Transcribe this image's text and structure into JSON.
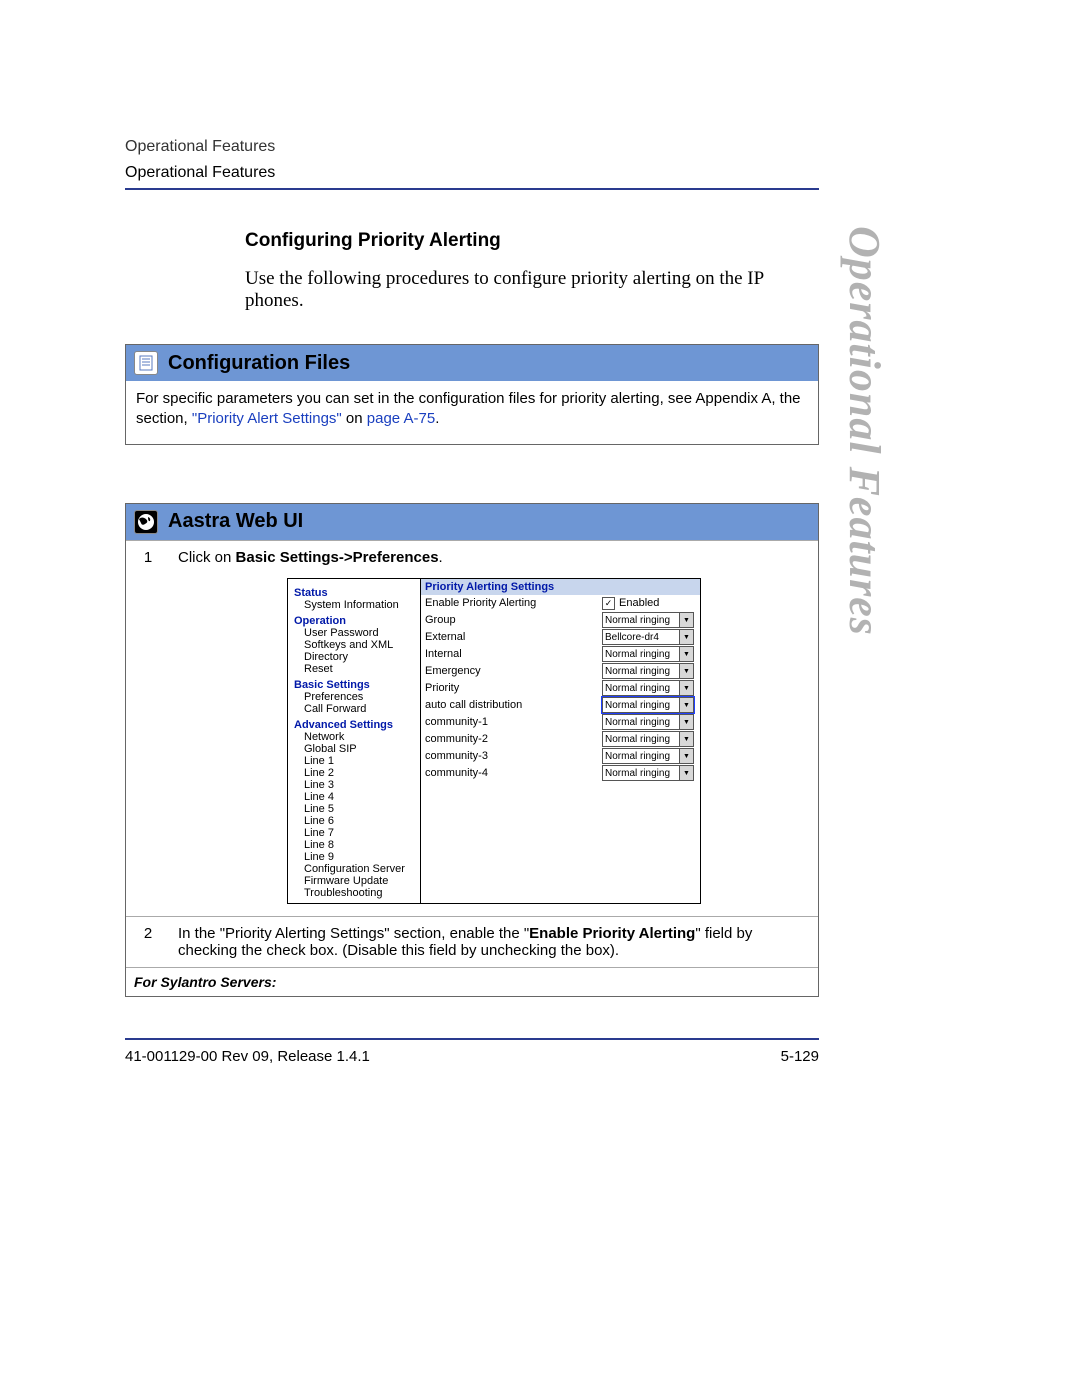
{
  "header": {
    "running1": "Operational Features",
    "running2": "Operational Features"
  },
  "sidetab": "Operational Features",
  "subhead": "Configuring Priority Alerting",
  "intro": "Use the following procedures to configure priority alerting on the IP phones.",
  "configFiles": {
    "title": "Configuration Files",
    "text_a": "For specific parameters you can set in the configuration files for priority alerting, see Appendix A, the section, ",
    "link1": "\"Priority Alert Settings\"",
    "mid": " on ",
    "link2": "page A-75",
    "end": "."
  },
  "webui": {
    "title": "Aastra Web UI",
    "step1": {
      "num": "1",
      "pre": "Click on ",
      "bold": "Basic Settings->Preferences",
      "post": "."
    },
    "nav": {
      "cat1": "Status",
      "c1_1": "System Information",
      "cat2": "Operation",
      "c2_1": "User Password",
      "c2_2": "Softkeys and XML",
      "c2_3": "Directory",
      "c2_4": "Reset",
      "cat3": "Basic Settings",
      "c3_1": "Preferences",
      "c3_2": "Call Forward",
      "cat4": "Advanced Settings",
      "c4_1": "Network",
      "c4_2": "Global SIP",
      "c4_3": "Line 1",
      "c4_4": "Line 2",
      "c4_5": "Line 3",
      "c4_6": "Line 4",
      "c4_7": "Line 5",
      "c4_8": "Line 6",
      "c4_9": "Line 7",
      "c4_10": "Line 8",
      "c4_11": "Line 9",
      "c4_12": "Configuration Server",
      "c4_13": "Firmware Update",
      "c4_14": "Troubleshooting"
    },
    "panel": {
      "caption": "Priority Alerting Settings",
      "rows": {
        "r0": {
          "label": "Enable Priority Alerting",
          "type": "chk",
          "value": "Enabled"
        },
        "r1": {
          "label": "Group",
          "type": "dd",
          "value": "Normal ringing"
        },
        "r2": {
          "label": "External",
          "type": "dd",
          "value": "Bellcore-dr4"
        },
        "r3": {
          "label": "Internal",
          "type": "dd",
          "value": "Normal ringing"
        },
        "r4": {
          "label": "Emergency",
          "type": "dd",
          "value": "Normal ringing"
        },
        "r5": {
          "label": "Priority",
          "type": "dd",
          "value": "Normal ringing"
        },
        "r6": {
          "label": "auto call distribution",
          "type": "dd",
          "value": "Normal ringing",
          "sel": true
        },
        "r7": {
          "label": "community-1",
          "type": "dd",
          "value": "Normal ringing"
        },
        "r8": {
          "label": "community-2",
          "type": "dd",
          "value": "Normal ringing"
        },
        "r9": {
          "label": "community-3",
          "type": "dd",
          "value": "Normal ringing"
        },
        "r10": {
          "label": "community-4",
          "type": "dd",
          "value": "Normal ringing"
        }
      }
    },
    "step2": {
      "num": "2",
      "pre": "In the \"Priority Alerting Settings\" section, enable the \"",
      "bold": "Enable Priority Alerting",
      "post": "\" field by checking the check box. (Disable this field by unchecking the box)."
    },
    "note": "For Sylantro Servers:"
  },
  "footer": {
    "left": "41-001129-00 Rev 09, Release 1.4.1",
    "right": "5-129"
  }
}
